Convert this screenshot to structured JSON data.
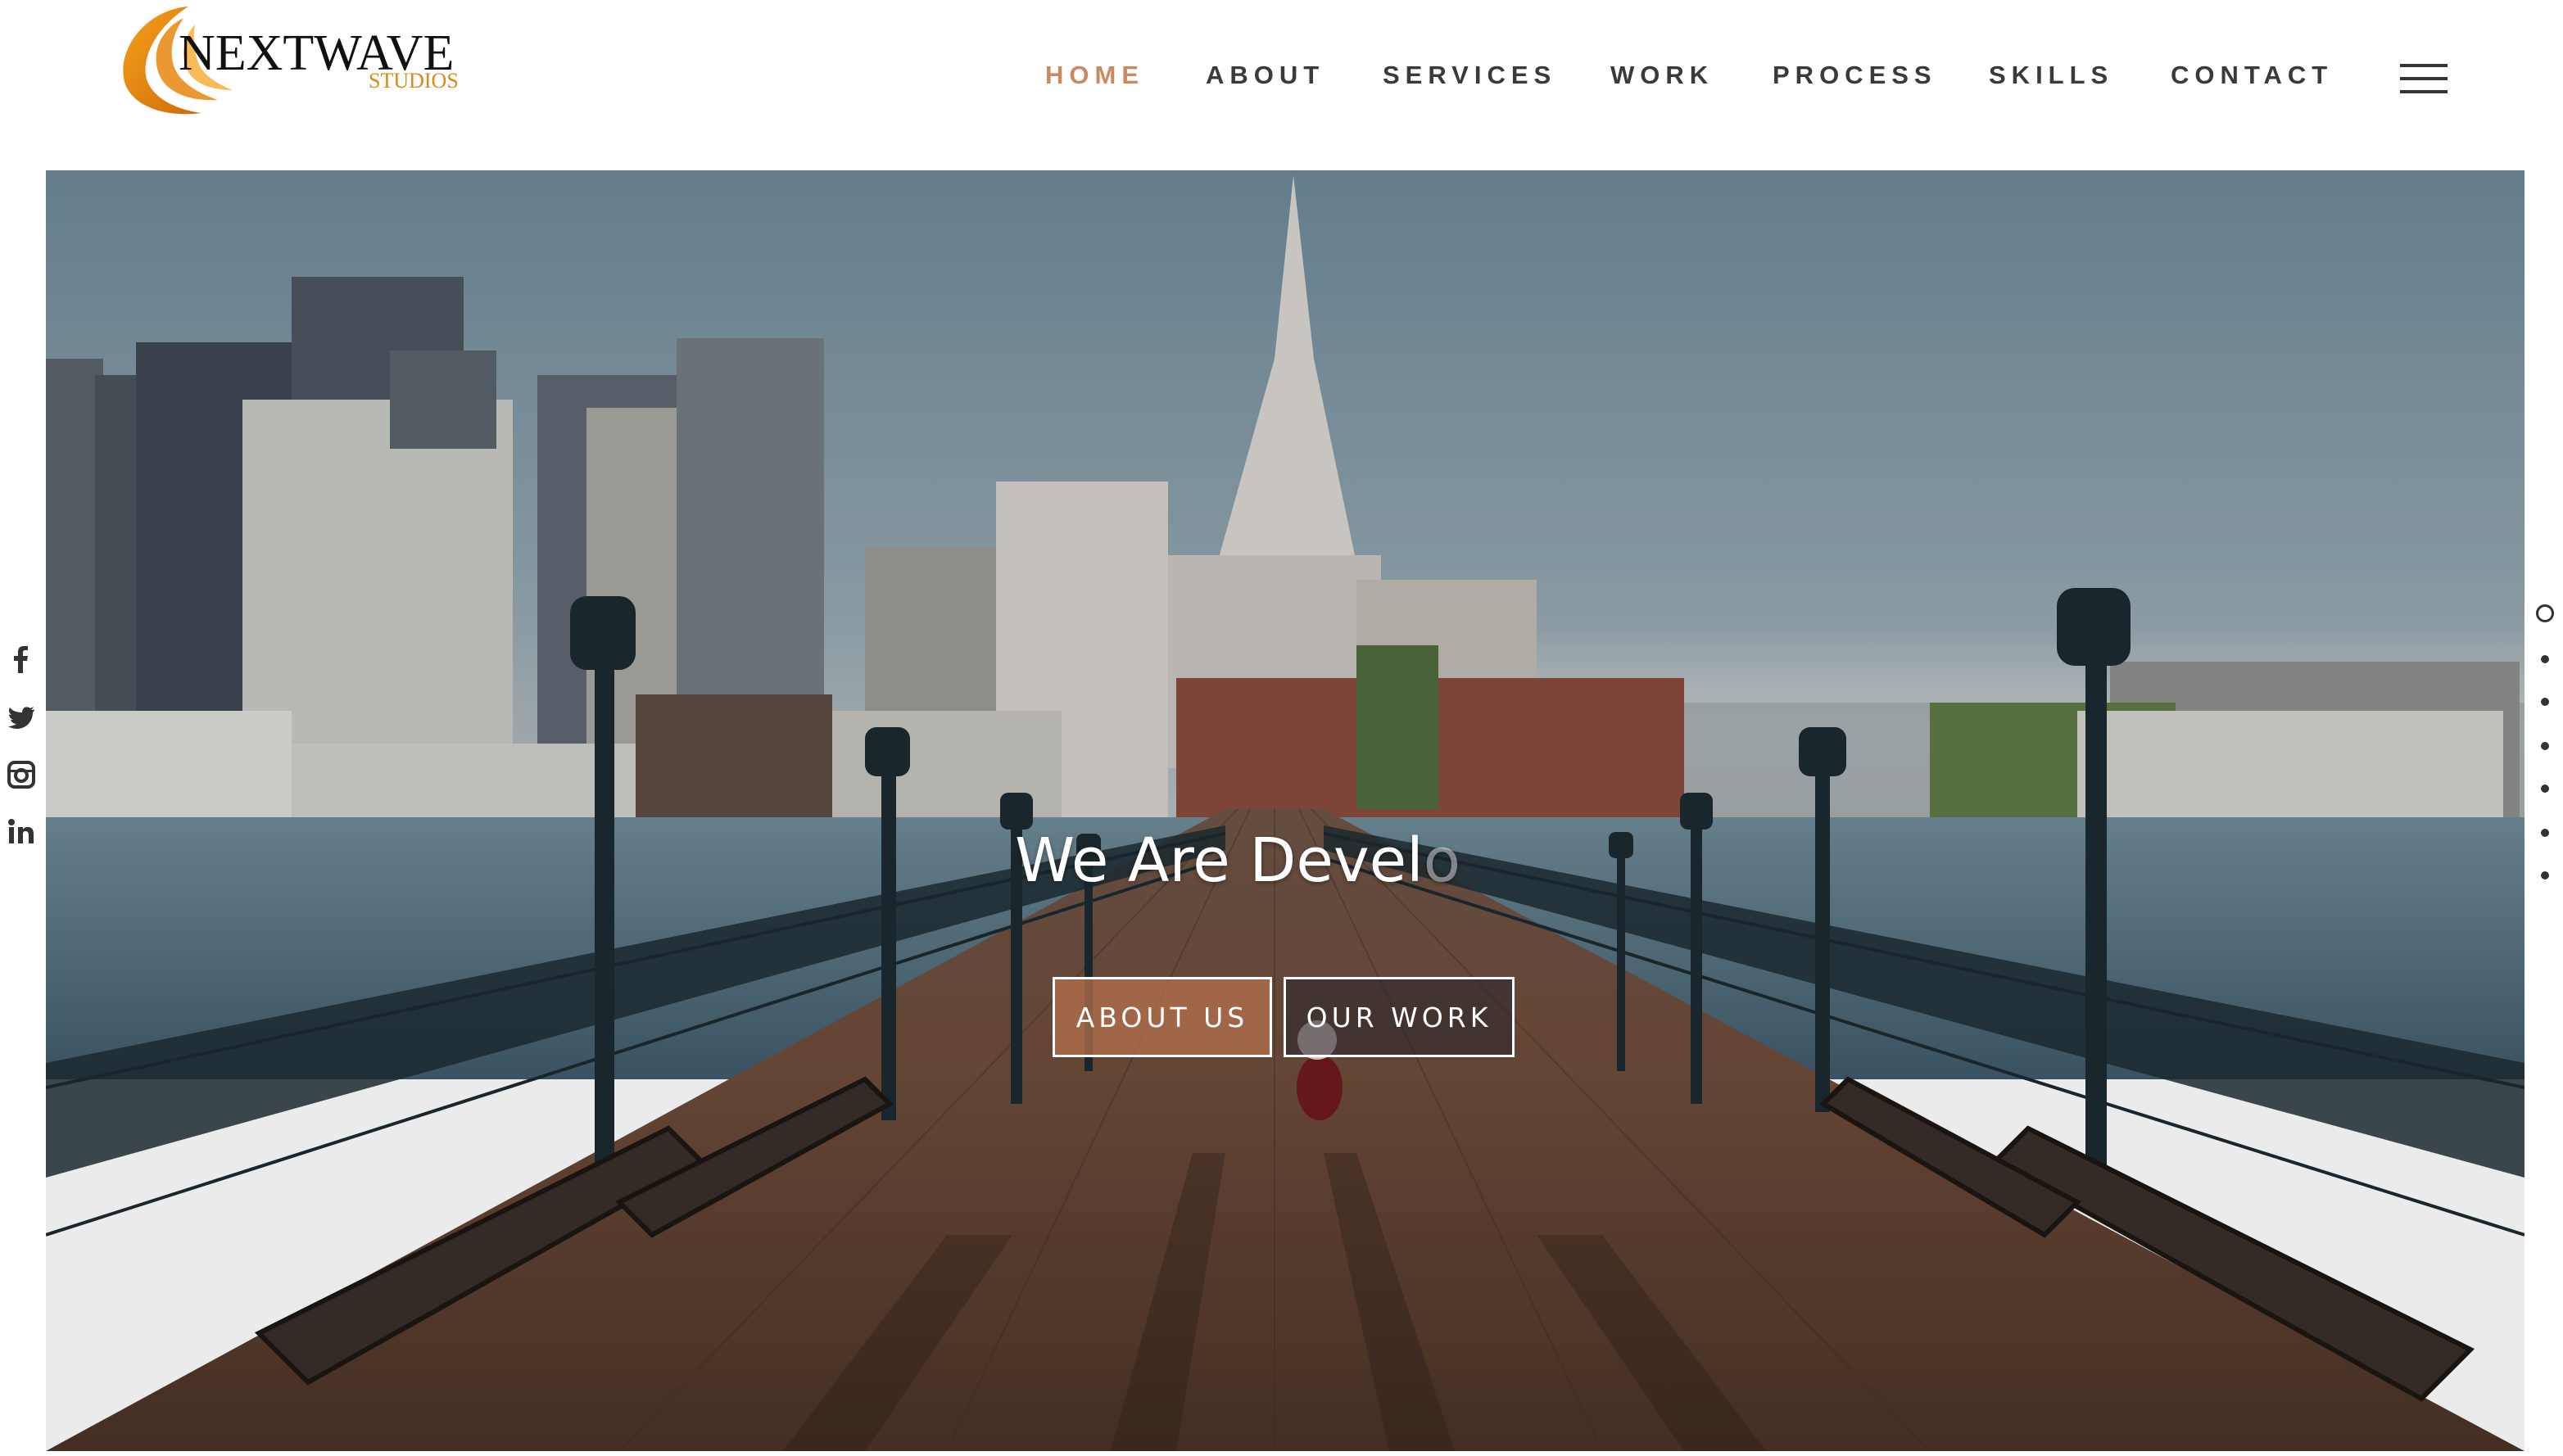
{
  "brand": {
    "name": "NEXTWAVE",
    "sub": "STUDIOS",
    "accent_color": "#d88a13"
  },
  "nav": {
    "items": [
      {
        "label": "HOME",
        "active": true
      },
      {
        "label": "ABOUT",
        "active": false
      },
      {
        "label": "SERVICES",
        "active": false
      },
      {
        "label": "WORK",
        "active": false
      },
      {
        "label": "PROCESS",
        "active": false
      },
      {
        "label": "SKILLS",
        "active": false
      },
      {
        "label": "CONTACT",
        "active": false
      }
    ],
    "active_color": "#c98a62",
    "menu_icon": "hamburger-icon"
  },
  "hero": {
    "headline_visible": "We Are Devel",
    "headline_fading": "o",
    "buttons": {
      "about": "ABOUT US",
      "work": "OUR WORK"
    }
  },
  "social": {
    "icons": [
      "facebook-icon",
      "twitter-icon",
      "instagram-icon",
      "linkedin-icon"
    ]
  },
  "section_dots": {
    "count": 7,
    "active_index": 0
  }
}
